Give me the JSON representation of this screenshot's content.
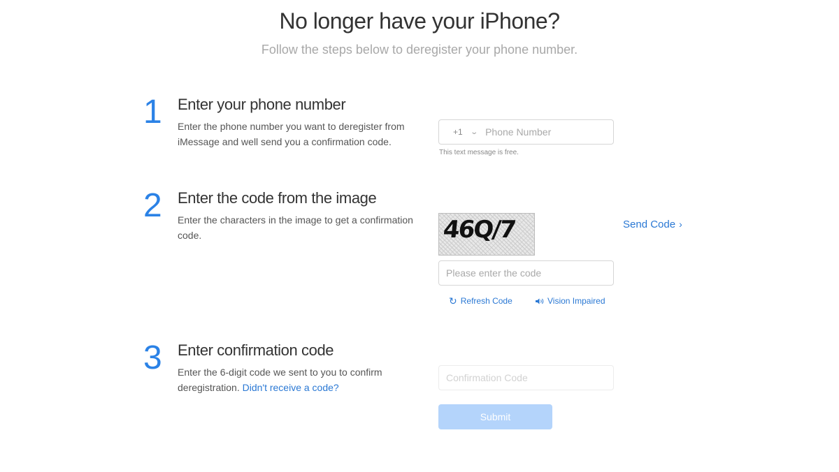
{
  "header": {
    "title": "No longer have your iPhone?",
    "subtitle": "Follow the steps below to deregister your phone number."
  },
  "step1": {
    "number": "1",
    "title": "Enter your phone number",
    "description": "Enter the phone number you want to deregister from iMessage and well send you a confirmation code.",
    "country_code": "+1",
    "phone_placeholder": "Phone Number",
    "hint": "This text message is free."
  },
  "step2": {
    "number": "2",
    "title": "Enter the code from the image",
    "description": "Enter the characters in the image to get a confirmation code.",
    "captcha_text": "46Q/7",
    "code_placeholder": "Please enter the code",
    "refresh_label": "Refresh Code",
    "vision_label": "Vision Impaired",
    "send_code_label": "Send Code"
  },
  "step3": {
    "number": "3",
    "title": "Enter confirmation code",
    "description": "Enter the 6-digit code we sent to you to confirm deregistration.",
    "resend_link": "Didn't receive a code?",
    "confirm_placeholder": "Confirmation Code",
    "submit_label": "Submit"
  },
  "icons": {
    "refresh": "refresh-icon",
    "speaker": "speaker-icon",
    "chevron_down": "chevron-down-icon",
    "chevron_right": "chevron-right-icon"
  },
  "colors": {
    "accent": "#2b82e6",
    "link": "#2a78d4",
    "submit_disabled": "#b4d4fb"
  }
}
